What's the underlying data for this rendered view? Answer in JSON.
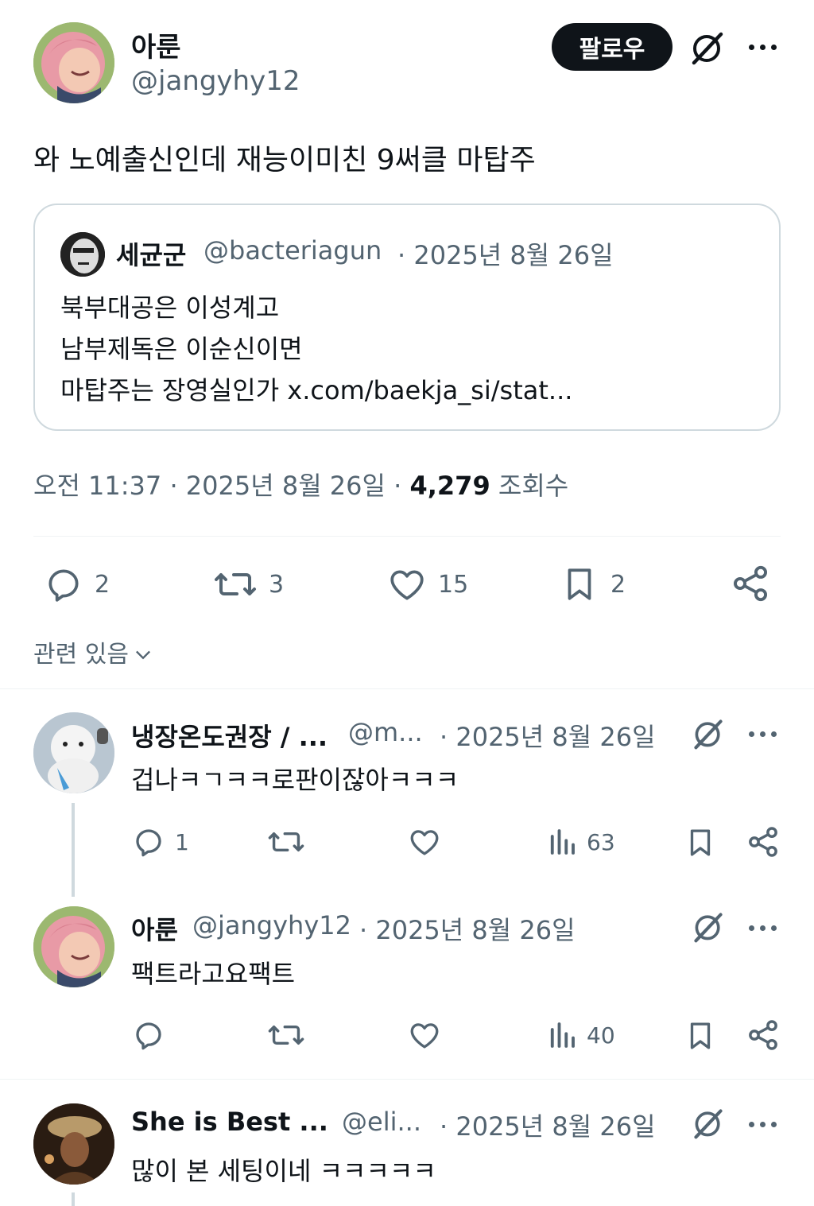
{
  "main_post": {
    "author_name": "아룬",
    "author_handle": "@jangyhy12",
    "follow_label": "팔로우",
    "text": "와 노예출신인데 재능이미친 9써클 마탑주",
    "quote": {
      "author_name": "세균군",
      "author_handle": "@bacteriagun",
      "date": "· 2025년 8월 26일",
      "lines": [
        "북부대공은 이성계고",
        "남부제독은 이순신이면",
        "마탑주는 장영실인가 x.com/baekja_si/stat..."
      ]
    },
    "time": "오전 11:37 · 2025년 8월 26일 ·",
    "views_count": "4,279",
    "views_label": "조회수",
    "stats": {
      "replies": "2",
      "reposts": "3",
      "likes": "15",
      "bookmarks": "2"
    },
    "related_label": "관련 있음"
  },
  "replies": [
    {
      "author_name": "냉장온도권장 / ...",
      "author_handle": "@m...",
      "date": "· 2025년 8월 26일",
      "text": "겁나ㅋㄱㅋㅋ로판이잖아ㅋㅋㅋ",
      "replies": "1",
      "views": "63"
    },
    {
      "author_name": "아룬",
      "author_handle": "@jangyhy12",
      "date": "· 2025년 8월 26일",
      "text": "팩트라고요팩트",
      "replies": "",
      "views": "40"
    },
    {
      "author_name": "She is Best ...",
      "author_handle": "@eli...",
      "date": "· 2025년 8월 26일",
      "text": "많이 본 세팅이네 ㅋㅋㅋㅋㅋ"
    }
  ],
  "icons": {
    "reply": "speech-bubble-icon",
    "repost": "repost-arrows-icon",
    "like": "heart-icon",
    "bookmark": "bookmark-icon",
    "share": "share-icon",
    "views": "bar-chart-icon",
    "grok": "grok-icon",
    "more": "more-dots-icon",
    "chevron": "chevron-down-icon"
  },
  "colors": {
    "text": "#0f1419",
    "secondary": "#536471",
    "border": "#cfd9de",
    "follow_bg": "#0f1419"
  }
}
